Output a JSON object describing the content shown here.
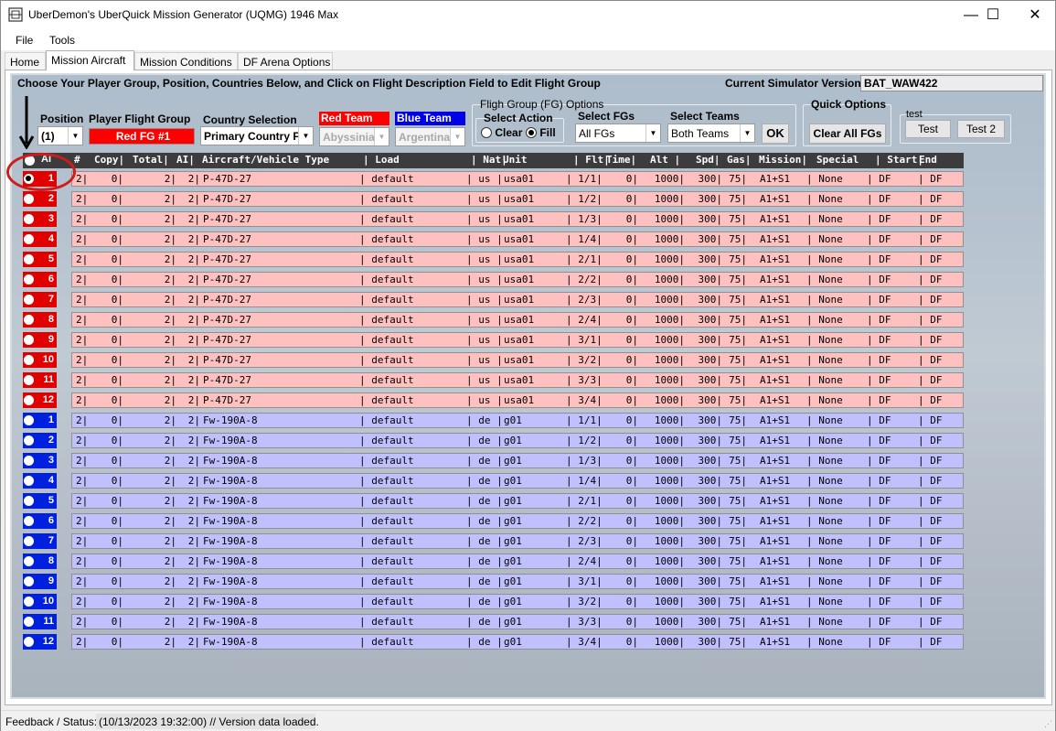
{
  "window": {
    "title": "UberDemon's UberQuick Mission Generator (UQMG) 1946 Max",
    "min": "—",
    "max": "☐",
    "close": "✕"
  },
  "menu": [
    "File",
    "Tools"
  ],
  "tabs": [
    "Home",
    "Mission Aircraft",
    "Mission Conditions",
    "DF Arena Options"
  ],
  "panel": {
    "instruction": "Choose Your Player Group, Position, Countries Below, and Click on Flight Description Field to Edit Flight Group",
    "sim_version_label": "Current Simulator Version:",
    "sim_version": "BAT_WAW422",
    "position_label": "Position",
    "position_value": "(1)",
    "player_fg_label": "Player Flight Group",
    "player_fg_value": "Red FG #1",
    "country_label": "Country Selection",
    "country_value": "Primary Country F",
    "red_team_label": "Red Team",
    "red_team_value": "Abyssinia",
    "blue_team_label": "Blue Team",
    "blue_team_value": "Argentina",
    "fg_options_title": "Fligh Group (FG) Options",
    "select_action_label": "Select Action",
    "clear_label": "Clear",
    "fill_label": "Fill",
    "select_fgs_label": "Select FGs",
    "select_fgs_value": "All FGs",
    "select_teams_label": "Select Teams",
    "select_teams_value": "Both Teams",
    "ok_label": "OK",
    "quick_options_title": "Quick Options",
    "clear_all_label": "Clear All FGs",
    "test_group_title": "test",
    "test_btn": "Test",
    "test2_btn": "Test 2"
  },
  "grid": {
    "header_ai": "AI",
    "columns": [
      "#",
      "Copy|",
      "Total|",
      "AI|",
      "Aircraft/Vehicle Type",
      "| Load",
      "| Nat|",
      "Unit",
      "| Flt|",
      "Time|",
      "Alt |",
      "Spd|",
      "Gas|",
      "Mission|",
      "Special",
      "| Start|",
      "End"
    ],
    "rows": [
      {
        "team": "red",
        "num": "1",
        "fg": "2|",
        "copy": "0|",
        "total": "2|",
        "ai": "2|",
        "type": "P-47D-27",
        "load": "| default",
        "nat": "| us |",
        "unit": "usa01",
        "flt": "| 1/1|",
        "time": "0|",
        "alt": "1000|",
        "spd": "300|",
        "gas": "75|",
        "mission": "A1+S1",
        "special": "| None",
        "start": "| DF",
        "end": "| DF"
      },
      {
        "team": "red",
        "num": "2",
        "fg": "2|",
        "copy": "0|",
        "total": "2|",
        "ai": "2|",
        "type": "P-47D-27",
        "load": "| default",
        "nat": "| us |",
        "unit": "usa01",
        "flt": "| 1/2|",
        "time": "0|",
        "alt": "1000|",
        "spd": "300|",
        "gas": "75|",
        "mission": "A1+S1",
        "special": "| None",
        "start": "| DF",
        "end": "| DF"
      },
      {
        "team": "red",
        "num": "3",
        "fg": "2|",
        "copy": "0|",
        "total": "2|",
        "ai": "2|",
        "type": "P-47D-27",
        "load": "| default",
        "nat": "| us |",
        "unit": "usa01",
        "flt": "| 1/3|",
        "time": "0|",
        "alt": "1000|",
        "spd": "300|",
        "gas": "75|",
        "mission": "A1+S1",
        "special": "| None",
        "start": "| DF",
        "end": "| DF"
      },
      {
        "team": "red",
        "num": "4",
        "fg": "2|",
        "copy": "0|",
        "total": "2|",
        "ai": "2|",
        "type": "P-47D-27",
        "load": "| default",
        "nat": "| us |",
        "unit": "usa01",
        "flt": "| 1/4|",
        "time": "0|",
        "alt": "1000|",
        "spd": "300|",
        "gas": "75|",
        "mission": "A1+S1",
        "special": "| None",
        "start": "| DF",
        "end": "| DF"
      },
      {
        "team": "red",
        "num": "5",
        "fg": "2|",
        "copy": "0|",
        "total": "2|",
        "ai": "2|",
        "type": "P-47D-27",
        "load": "| default",
        "nat": "| us |",
        "unit": "usa01",
        "flt": "| 2/1|",
        "time": "0|",
        "alt": "1000|",
        "spd": "300|",
        "gas": "75|",
        "mission": "A1+S1",
        "special": "| None",
        "start": "| DF",
        "end": "| DF"
      },
      {
        "team": "red",
        "num": "6",
        "fg": "2|",
        "copy": "0|",
        "total": "2|",
        "ai": "2|",
        "type": "P-47D-27",
        "load": "| default",
        "nat": "| us |",
        "unit": "usa01",
        "flt": "| 2/2|",
        "time": "0|",
        "alt": "1000|",
        "spd": "300|",
        "gas": "75|",
        "mission": "A1+S1",
        "special": "| None",
        "start": "| DF",
        "end": "| DF"
      },
      {
        "team": "red",
        "num": "7",
        "fg": "2|",
        "copy": "0|",
        "total": "2|",
        "ai": "2|",
        "type": "P-47D-27",
        "load": "| default",
        "nat": "| us |",
        "unit": "usa01",
        "flt": "| 2/3|",
        "time": "0|",
        "alt": "1000|",
        "spd": "300|",
        "gas": "75|",
        "mission": "A1+S1",
        "special": "| None",
        "start": "| DF",
        "end": "| DF"
      },
      {
        "team": "red",
        "num": "8",
        "fg": "2|",
        "copy": "0|",
        "total": "2|",
        "ai": "2|",
        "type": "P-47D-27",
        "load": "| default",
        "nat": "| us |",
        "unit": "usa01",
        "flt": "| 2/4|",
        "time": "0|",
        "alt": "1000|",
        "spd": "300|",
        "gas": "75|",
        "mission": "A1+S1",
        "special": "| None",
        "start": "| DF",
        "end": "| DF"
      },
      {
        "team": "red",
        "num": "9",
        "fg": "2|",
        "copy": "0|",
        "total": "2|",
        "ai": "2|",
        "type": "P-47D-27",
        "load": "| default",
        "nat": "| us |",
        "unit": "usa01",
        "flt": "| 3/1|",
        "time": "0|",
        "alt": "1000|",
        "spd": "300|",
        "gas": "75|",
        "mission": "A1+S1",
        "special": "| None",
        "start": "| DF",
        "end": "| DF"
      },
      {
        "team": "red",
        "num": "10",
        "fg": "2|",
        "copy": "0|",
        "total": "2|",
        "ai": "2|",
        "type": "P-47D-27",
        "load": "| default",
        "nat": "| us |",
        "unit": "usa01",
        "flt": "| 3/2|",
        "time": "0|",
        "alt": "1000|",
        "spd": "300|",
        "gas": "75|",
        "mission": "A1+S1",
        "special": "| None",
        "start": "| DF",
        "end": "| DF"
      },
      {
        "team": "red",
        "num": "11",
        "fg": "2|",
        "copy": "0|",
        "total": "2|",
        "ai": "2|",
        "type": "P-47D-27",
        "load": "| default",
        "nat": "| us |",
        "unit": "usa01",
        "flt": "| 3/3|",
        "time": "0|",
        "alt": "1000|",
        "spd": "300|",
        "gas": "75|",
        "mission": "A1+S1",
        "special": "| None",
        "start": "| DF",
        "end": "| DF"
      },
      {
        "team": "red",
        "num": "12",
        "fg": "2|",
        "copy": "0|",
        "total": "2|",
        "ai": "2|",
        "type": "P-47D-27",
        "load": "| default",
        "nat": "| us |",
        "unit": "usa01",
        "flt": "| 3/4|",
        "time": "0|",
        "alt": "1000|",
        "spd": "300|",
        "gas": "75|",
        "mission": "A1+S1",
        "special": "| None",
        "start": "| DF",
        "end": "| DF"
      },
      {
        "team": "blue",
        "num": "1",
        "fg": "2|",
        "copy": "0|",
        "total": "2|",
        "ai": "2|",
        "type": "Fw-190A-8",
        "load": "| default",
        "nat": "| de |",
        "unit": "g01",
        "flt": "| 1/1|",
        "time": "0|",
        "alt": "1000|",
        "spd": "300|",
        "gas": "75|",
        "mission": "A1+S1",
        "special": "| None",
        "start": "| DF",
        "end": "| DF"
      },
      {
        "team": "blue",
        "num": "2",
        "fg": "2|",
        "copy": "0|",
        "total": "2|",
        "ai": "2|",
        "type": "Fw-190A-8",
        "load": "| default",
        "nat": "| de |",
        "unit": "g01",
        "flt": "| 1/2|",
        "time": "0|",
        "alt": "1000|",
        "spd": "300|",
        "gas": "75|",
        "mission": "A1+S1",
        "special": "| None",
        "start": "| DF",
        "end": "| DF"
      },
      {
        "team": "blue",
        "num": "3",
        "fg": "2|",
        "copy": "0|",
        "total": "2|",
        "ai": "2|",
        "type": "Fw-190A-8",
        "load": "| default",
        "nat": "| de |",
        "unit": "g01",
        "flt": "| 1/3|",
        "time": "0|",
        "alt": "1000|",
        "spd": "300|",
        "gas": "75|",
        "mission": "A1+S1",
        "special": "| None",
        "start": "| DF",
        "end": "| DF"
      },
      {
        "team": "blue",
        "num": "4",
        "fg": "2|",
        "copy": "0|",
        "total": "2|",
        "ai": "2|",
        "type": "Fw-190A-8",
        "load": "| default",
        "nat": "| de |",
        "unit": "g01",
        "flt": "| 1/4|",
        "time": "0|",
        "alt": "1000|",
        "spd": "300|",
        "gas": "75|",
        "mission": "A1+S1",
        "special": "| None",
        "start": "| DF",
        "end": "| DF"
      },
      {
        "team": "blue",
        "num": "5",
        "fg": "2|",
        "copy": "0|",
        "total": "2|",
        "ai": "2|",
        "type": "Fw-190A-8",
        "load": "| default",
        "nat": "| de |",
        "unit": "g01",
        "flt": "| 2/1|",
        "time": "0|",
        "alt": "1000|",
        "spd": "300|",
        "gas": "75|",
        "mission": "A1+S1",
        "special": "| None",
        "start": "| DF",
        "end": "| DF"
      },
      {
        "team": "blue",
        "num": "6",
        "fg": "2|",
        "copy": "0|",
        "total": "2|",
        "ai": "2|",
        "type": "Fw-190A-8",
        "load": "| default",
        "nat": "| de |",
        "unit": "g01",
        "flt": "| 2/2|",
        "time": "0|",
        "alt": "1000|",
        "spd": "300|",
        "gas": "75|",
        "mission": "A1+S1",
        "special": "| None",
        "start": "| DF",
        "end": "| DF"
      },
      {
        "team": "blue",
        "num": "7",
        "fg": "2|",
        "copy": "0|",
        "total": "2|",
        "ai": "2|",
        "type": "Fw-190A-8",
        "load": "| default",
        "nat": "| de |",
        "unit": "g01",
        "flt": "| 2/3|",
        "time": "0|",
        "alt": "1000|",
        "spd": "300|",
        "gas": "75|",
        "mission": "A1+S1",
        "special": "| None",
        "start": "| DF",
        "end": "| DF"
      },
      {
        "team": "blue",
        "num": "8",
        "fg": "2|",
        "copy": "0|",
        "total": "2|",
        "ai": "2|",
        "type": "Fw-190A-8",
        "load": "| default",
        "nat": "| de |",
        "unit": "g01",
        "flt": "| 2/4|",
        "time": "0|",
        "alt": "1000|",
        "spd": "300|",
        "gas": "75|",
        "mission": "A1+S1",
        "special": "| None",
        "start": "| DF",
        "end": "| DF"
      },
      {
        "team": "blue",
        "num": "9",
        "fg": "2|",
        "copy": "0|",
        "total": "2|",
        "ai": "2|",
        "type": "Fw-190A-8",
        "load": "| default",
        "nat": "| de |",
        "unit": "g01",
        "flt": "| 3/1|",
        "time": "0|",
        "alt": "1000|",
        "spd": "300|",
        "gas": "75|",
        "mission": "A1+S1",
        "special": "| None",
        "start": "| DF",
        "end": "| DF"
      },
      {
        "team": "blue",
        "num": "10",
        "fg": "2|",
        "copy": "0|",
        "total": "2|",
        "ai": "2|",
        "type": "Fw-190A-8",
        "load": "| default",
        "nat": "| de |",
        "unit": "g01",
        "flt": "| 3/2|",
        "time": "0|",
        "alt": "1000|",
        "spd": "300|",
        "gas": "75|",
        "mission": "A1+S1",
        "special": "| None",
        "start": "| DF",
        "end": "| DF"
      },
      {
        "team": "blue",
        "num": "11",
        "fg": "2|",
        "copy": "0|",
        "total": "2|",
        "ai": "2|",
        "type": "Fw-190A-8",
        "load": "| default",
        "nat": "| de |",
        "unit": "g01",
        "flt": "| 3/3|",
        "time": "0|",
        "alt": "1000|",
        "spd": "300|",
        "gas": "75|",
        "mission": "A1+S1",
        "special": "| None",
        "start": "| DF",
        "end": "| DF"
      },
      {
        "team": "blue",
        "num": "12",
        "fg": "2|",
        "copy": "0|",
        "total": "2|",
        "ai": "2|",
        "type": "Fw-190A-8",
        "load": "| default",
        "nat": "| de |",
        "unit": "g01",
        "flt": "| 3/4|",
        "time": "0|",
        "alt": "1000|",
        "spd": "300|",
        "gas": "75|",
        "mission": "A1+S1",
        "special": "| None",
        "start": "| DF",
        "end": "| DF"
      }
    ]
  },
  "status": {
    "label": "Feedback / Status:",
    "text": "(10/13/2023 19:32:00) // Version data loaded."
  },
  "colors": {
    "red_btn": "#e00000",
    "blue_btn": "#0020e0",
    "red_row": "#ffc0c0",
    "blue_row": "#c0c0ff",
    "red_label": "#ff0000",
    "blue_label": "#0000e6"
  }
}
